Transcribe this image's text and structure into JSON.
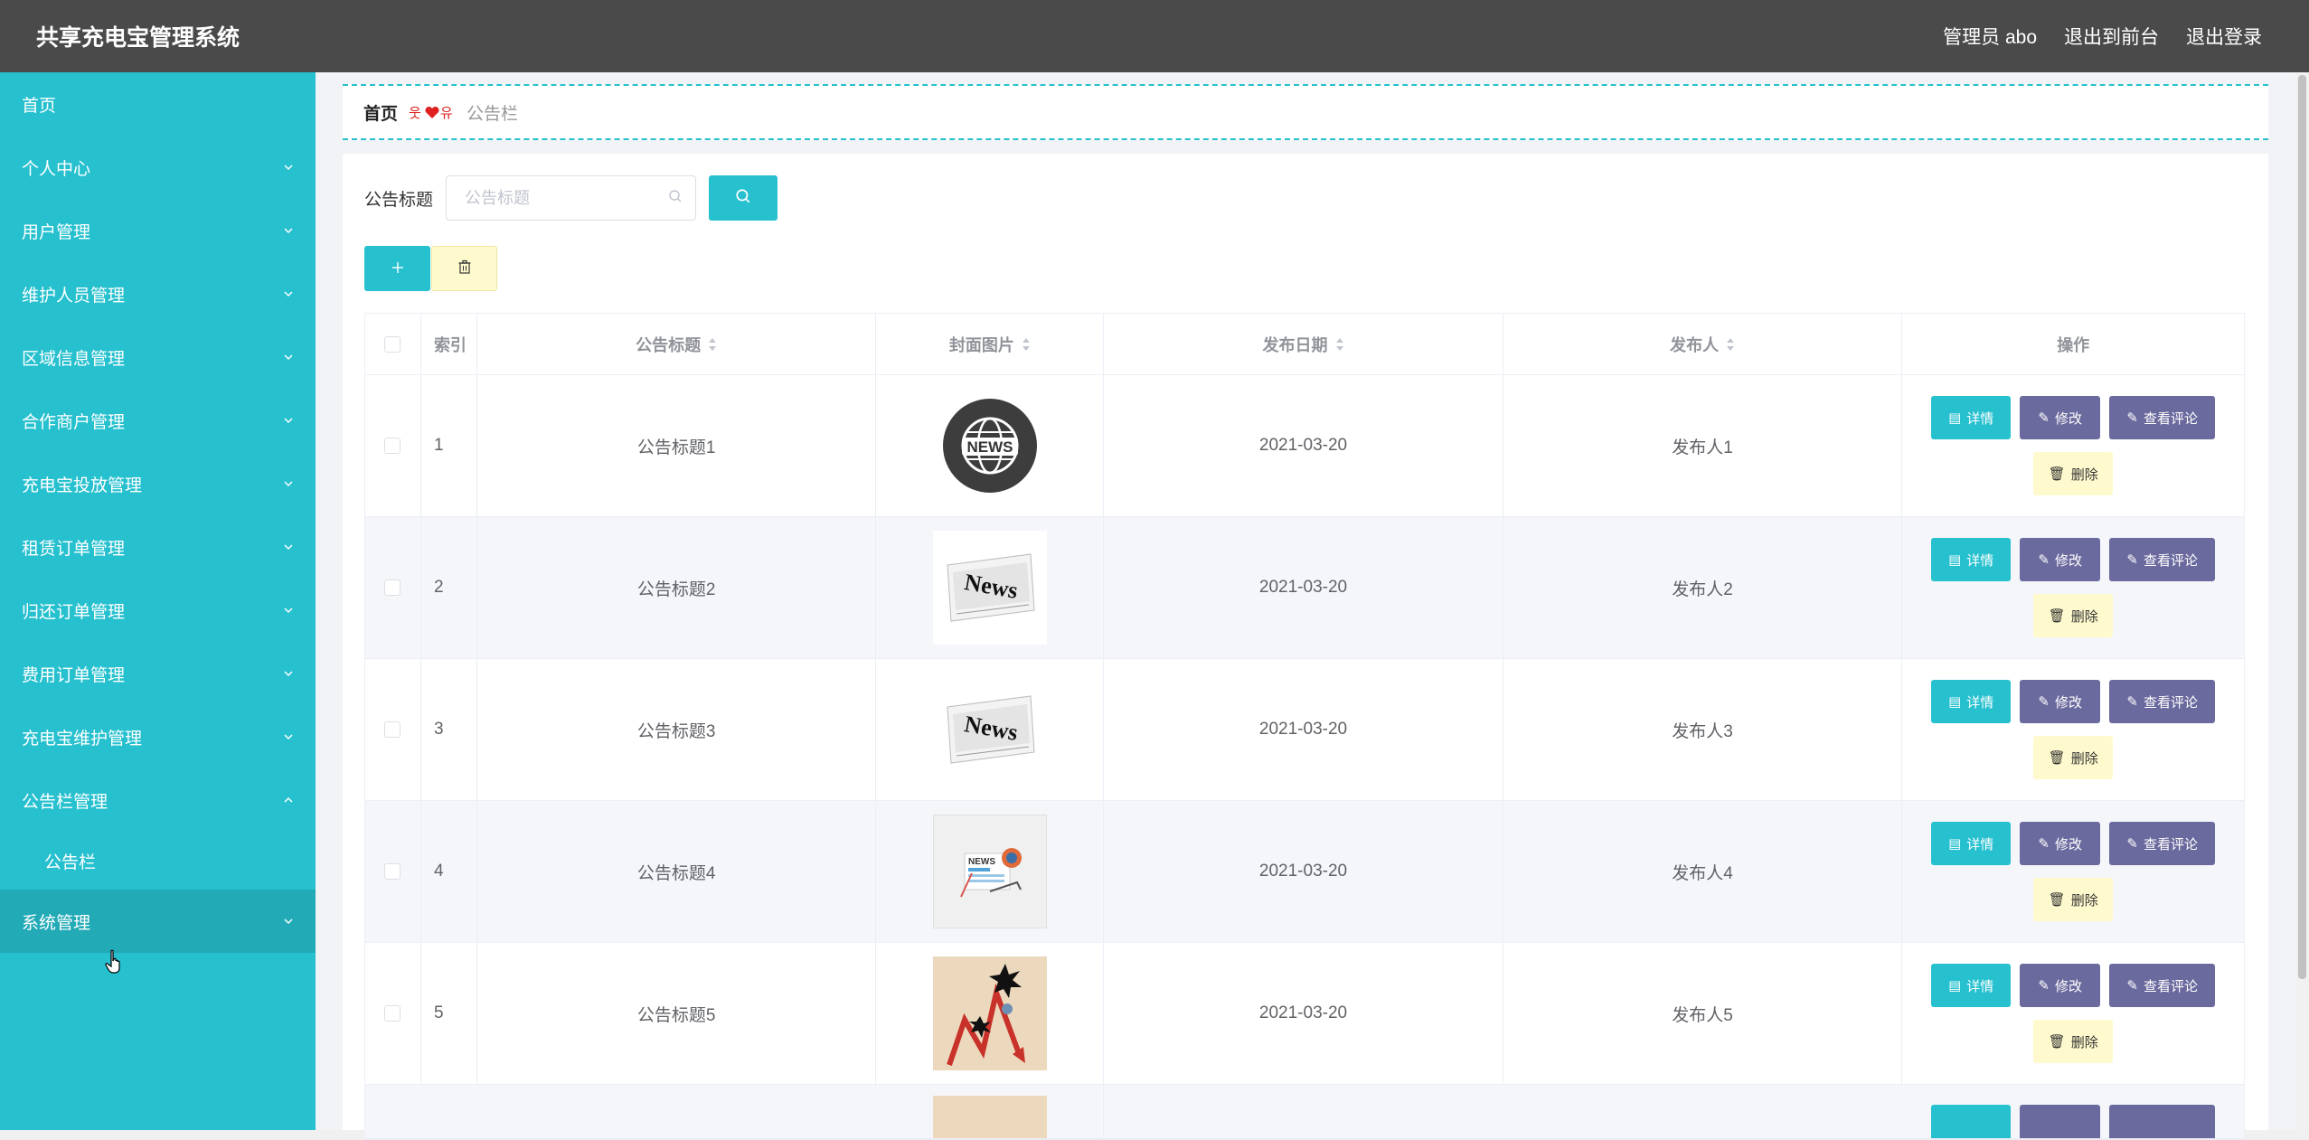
{
  "header": {
    "title": "共享充电宝管理系统",
    "user_label": "管理员 abo",
    "to_front": "退出到前台",
    "logout": "退出登录"
  },
  "sidebar": {
    "items": [
      {
        "label": "首页",
        "chevron": "none"
      },
      {
        "label": "个人中心",
        "chevron": "down"
      },
      {
        "label": "用户管理",
        "chevron": "down"
      },
      {
        "label": "维护人员管理",
        "chevron": "down"
      },
      {
        "label": "区域信息管理",
        "chevron": "down"
      },
      {
        "label": "合作商户管理",
        "chevron": "down"
      },
      {
        "label": "充电宝投放管理",
        "chevron": "down"
      },
      {
        "label": "租赁订单管理",
        "chevron": "down"
      },
      {
        "label": "归还订单管理",
        "chevron": "down"
      },
      {
        "label": "费用订单管理",
        "chevron": "down"
      },
      {
        "label": "充电宝维护管理",
        "chevron": "down"
      },
      {
        "label": "公告栏管理",
        "chevron": "up"
      },
      {
        "label": "公告栏",
        "chevron": "none"
      },
      {
        "label": "系统管理",
        "chevron": "down"
      }
    ]
  },
  "breadcrumb": {
    "home": "首页",
    "current": "公告栏"
  },
  "search": {
    "label": "公告标题",
    "placeholder": "公告标题"
  },
  "table": {
    "headers": {
      "index": "索引",
      "title": "公告标题",
      "cover": "封面图片",
      "date": "发布日期",
      "publisher": "发布人",
      "ops": "操作"
    },
    "rows": [
      {
        "index": "1",
        "title": "公告标题1",
        "date": "2021-03-20",
        "publisher": "发布人1",
        "thumb": "globe-news"
      },
      {
        "index": "2",
        "title": "公告标题2",
        "date": "2021-03-20",
        "publisher": "发布人2",
        "thumb": "newspaper"
      },
      {
        "index": "3",
        "title": "公告标题3",
        "date": "2021-03-20",
        "publisher": "发布人3",
        "thumb": "newspaper"
      },
      {
        "index": "4",
        "title": "公告标题4",
        "date": "2021-03-20",
        "publisher": "发布人4",
        "thumb": "news-doc"
      },
      {
        "index": "5",
        "title": "公告标题5",
        "date": "2021-03-20",
        "publisher": "发布人5",
        "thumb": "chart-crash"
      }
    ],
    "op_labels": {
      "detail": "详情",
      "edit": "修改",
      "comment": "查看评论",
      "delete": "删除"
    }
  },
  "colors": {
    "accent": "#26c0cf",
    "header_bg": "#4a4a4a",
    "purple": "#6b6a9e",
    "yellow": "#fffacd"
  }
}
